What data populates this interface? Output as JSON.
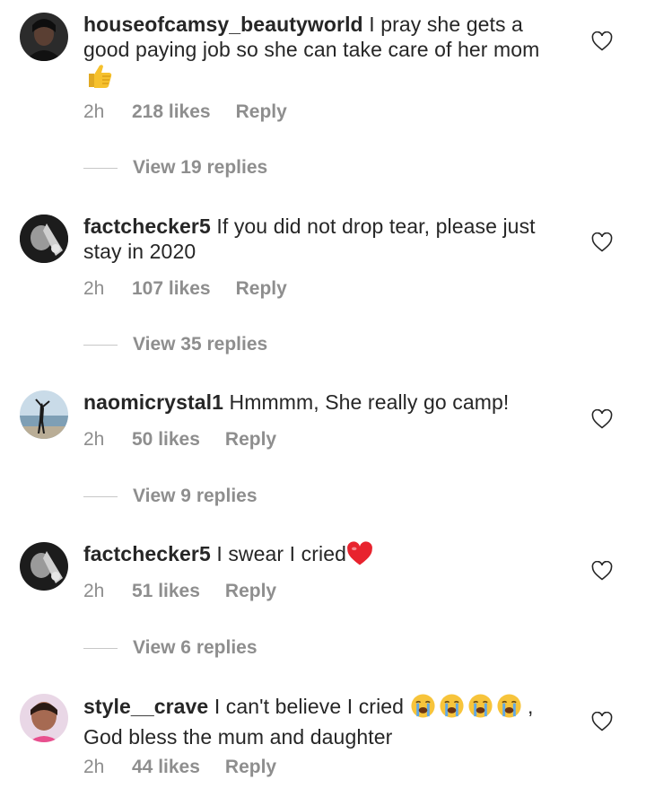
{
  "comments": [
    {
      "username": "houseofcamsy_beautyworld",
      "text": " I pray she gets a good paying job so she can take care of her mom",
      "emoji": "thumbs-up-icon",
      "time": "2h",
      "likes": "218 likes",
      "reply": "Reply",
      "view_replies": "View 19 replies"
    },
    {
      "username": "factchecker5",
      "text": " If you did not drop tear, please just stay in 2020",
      "time": "2h",
      "likes": "107 likes",
      "reply": "Reply",
      "view_replies": "View 35 replies"
    },
    {
      "username": "naomicrystal1",
      "text": " Hmmmm, She really go camp!",
      "time": "2h",
      "likes": "50 likes",
      "reply": "Reply",
      "view_replies": "View 9 replies"
    },
    {
      "username": "factchecker5",
      "text": " I swear I cried",
      "emoji": "red-heart-icon",
      "time": "2h",
      "likes": "51 likes",
      "reply": "Reply",
      "view_replies": "View 6 replies"
    },
    {
      "username": "style__crave",
      "text": " I can't believe I cried",
      "text_after_emoji": " ,",
      "text_line2": "God bless the mum and daughter",
      "emoji": "crying-face-icon",
      "time": "2h",
      "likes": "44 likes",
      "reply": "Reply"
    }
  ],
  "colors": {
    "text": "#262626",
    "secondary": "#8e8e8e",
    "heart_emoji": "#e8232e",
    "thumb_emoji": "#f6c12d",
    "cry_emoji": "#f7c43b"
  }
}
